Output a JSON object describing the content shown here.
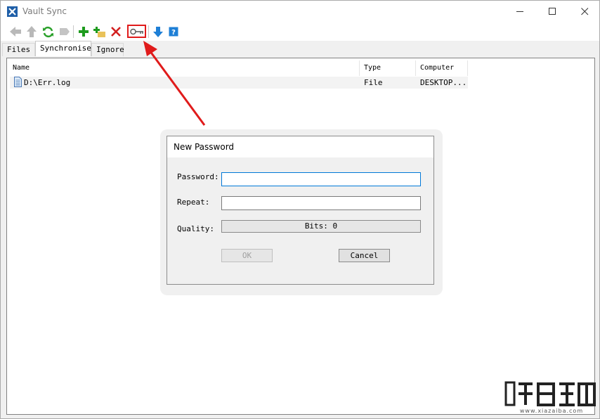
{
  "window": {
    "title": "Vault Sync",
    "accent": "#1f5fa8"
  },
  "toolbar": {
    "buttons": [
      {
        "icon": "back-arrow-icon",
        "enabled": false
      },
      {
        "icon": "up-arrow-icon",
        "enabled": false
      },
      {
        "icon": "refresh-icon",
        "enabled": true
      },
      {
        "icon": "forward-icon",
        "enabled": false
      },
      {
        "icon": "add-icon",
        "enabled": true
      },
      {
        "icon": "add-folder-icon",
        "enabled": true
      },
      {
        "icon": "delete-icon",
        "enabled": true
      },
      {
        "icon": "key-icon",
        "enabled": true,
        "highlighted": true
      },
      {
        "icon": "download-icon",
        "enabled": true
      },
      {
        "icon": "help-icon",
        "enabled": true
      }
    ]
  },
  "tabs": [
    {
      "label": "Files",
      "active": false
    },
    {
      "label": "Synchronise",
      "active": true
    },
    {
      "label": "Ignore",
      "active": false
    }
  ],
  "list": {
    "columns": [
      "Name",
      "Type",
      "Computer"
    ],
    "rows": [
      {
        "name": "D:\\Err.log",
        "type": "File",
        "computer": "DESKTOP..."
      }
    ]
  },
  "dialog": {
    "title": "New Password",
    "password_label": "Password:",
    "repeat_label": "Repeat:",
    "quality_label": "Quality:",
    "quality_value": "Bits: 0",
    "ok_label": "OK",
    "cancel_label": "Cancel",
    "ok_enabled": false
  },
  "annotation": {
    "color": "#e01b1b"
  },
  "watermark": {
    "text": "www.xiazaiba.com"
  }
}
